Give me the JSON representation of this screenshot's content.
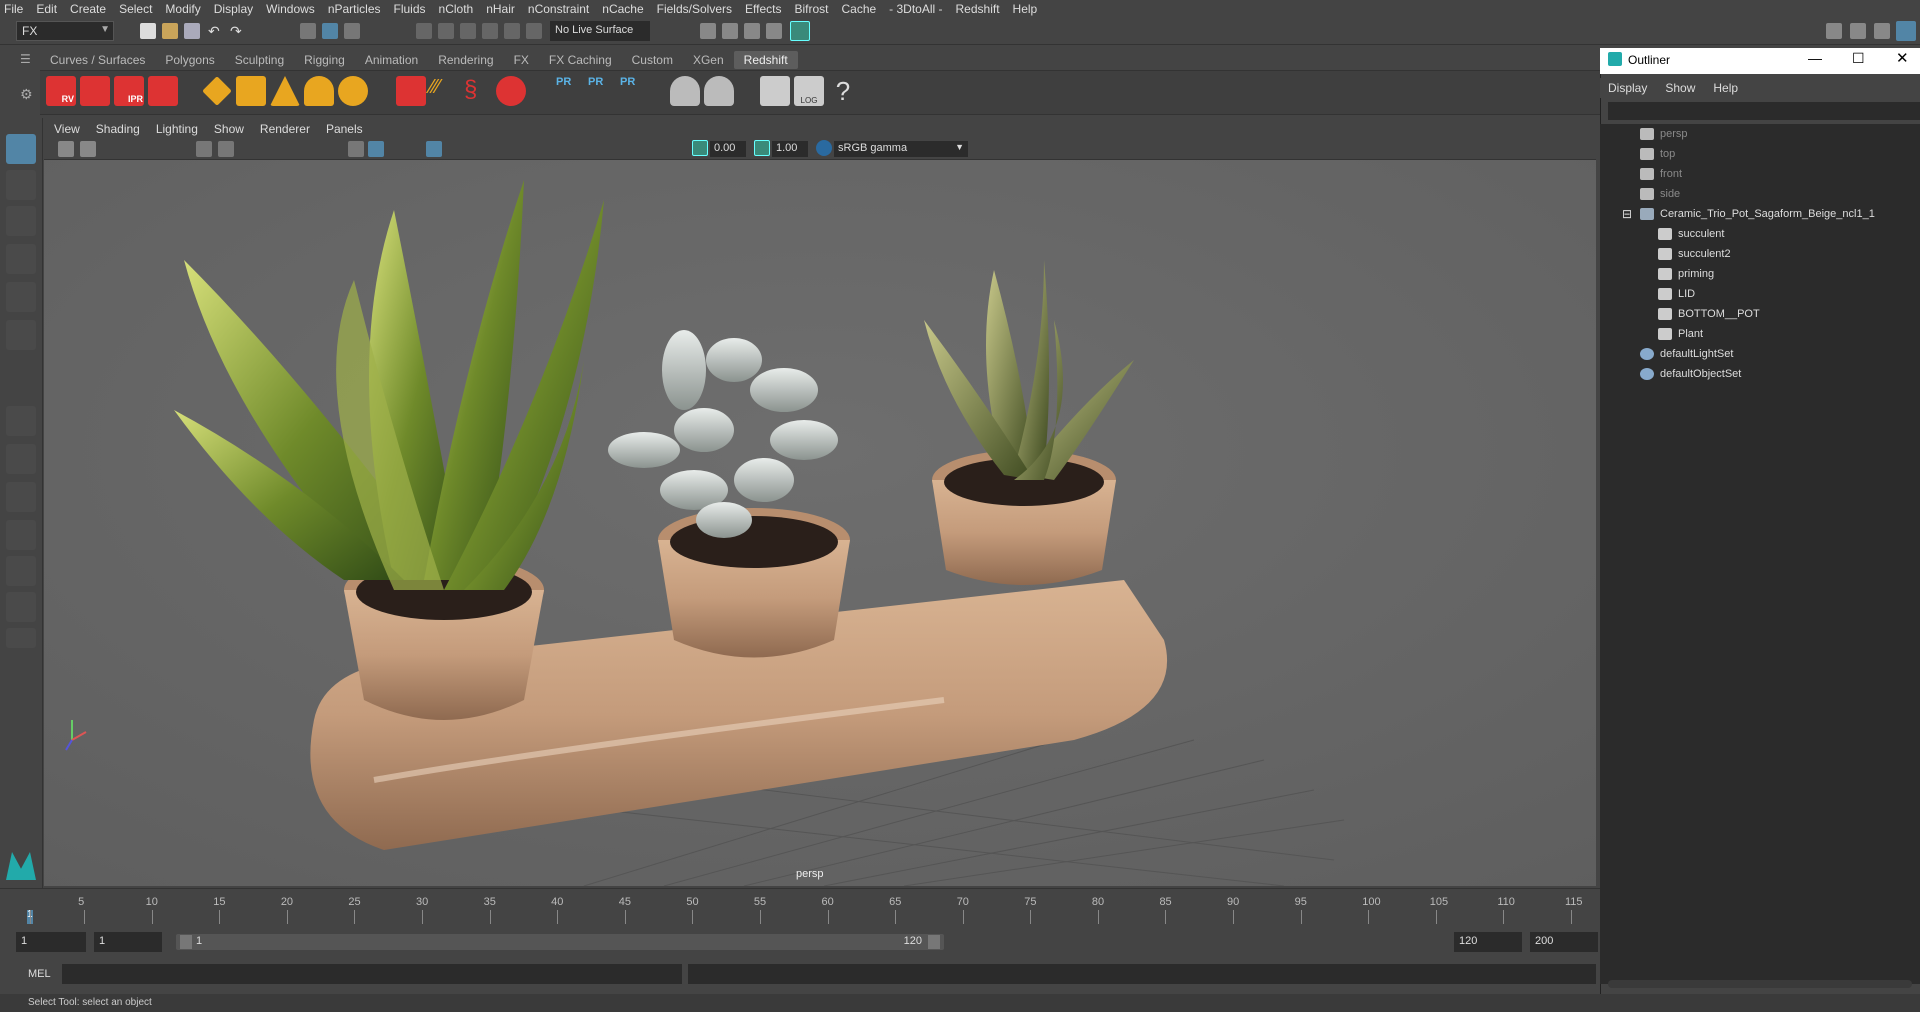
{
  "menubar": {
    "items": [
      "File",
      "Edit",
      "Create",
      "Select",
      "Modify",
      "Display",
      "Windows",
      "nParticles",
      "Fluids",
      "nCloth",
      "nHair",
      "nConstraint",
      "nCache",
      "Fields/Solvers",
      "Effects",
      "Bifrost",
      "Cache",
      "- 3DtoAll -",
      "Redshift",
      "Help"
    ]
  },
  "status": {
    "mode": "FX",
    "live_surface": "No Live Surface"
  },
  "shelf_tabs": [
    {
      "label": "Curves / Surfaces"
    },
    {
      "label": "Polygons"
    },
    {
      "label": "Sculpting"
    },
    {
      "label": "Rigging"
    },
    {
      "label": "Animation"
    },
    {
      "label": "Rendering"
    },
    {
      "label": "FX"
    },
    {
      "label": "FX Caching"
    },
    {
      "label": "Custom"
    },
    {
      "label": "XGen"
    },
    {
      "label": "Redshift",
      "active": true
    }
  ],
  "shelf_icons": {
    "rv": "RV",
    "ipr": "IPR",
    "pr": "PR",
    "log": "LOG",
    "help": "?"
  },
  "viewport": {
    "menu": [
      "View",
      "Shading",
      "Lighting",
      "Show",
      "Renderer",
      "Panels"
    ],
    "exposure": "0.00",
    "gamma": "1.00",
    "colorspace": "sRGB gamma",
    "camera_label": "persp"
  },
  "outliner": {
    "title": "Outliner",
    "menu": [
      "Display",
      "Show",
      "Help"
    ],
    "items": [
      {
        "label": "persp",
        "depth": 0,
        "dim": true,
        "icon": "camera-icon"
      },
      {
        "label": "top",
        "depth": 0,
        "dim": true,
        "icon": "camera-icon"
      },
      {
        "label": "front",
        "depth": 0,
        "dim": true,
        "icon": "camera-icon"
      },
      {
        "label": "side",
        "depth": 0,
        "dim": true,
        "icon": "camera-icon"
      },
      {
        "label": "Ceramic_Trio_Pot_Sagaform_Beige_ncl1_1",
        "depth": 0,
        "icon": "group-icon",
        "expanded": true
      },
      {
        "label": "succulent",
        "depth": 1,
        "icon": "mesh-icon"
      },
      {
        "label": "succulent2",
        "depth": 1,
        "icon": "mesh-icon"
      },
      {
        "label": "priming",
        "depth": 1,
        "icon": "mesh-icon"
      },
      {
        "label": "LID",
        "depth": 1,
        "icon": "mesh-icon"
      },
      {
        "label": "BOTTOM__POT",
        "depth": 1,
        "icon": "mesh-icon"
      },
      {
        "label": "Plant",
        "depth": 1,
        "icon": "mesh-icon"
      },
      {
        "label": "defaultLightSet",
        "depth": 0,
        "icon": "set-icon"
      },
      {
        "label": "defaultObjectSet",
        "depth": 0,
        "icon": "set-icon"
      }
    ]
  },
  "timeline": {
    "ticks": [
      "1",
      "5",
      "10",
      "15",
      "20",
      "25",
      "30",
      "35",
      "40",
      "45",
      "50",
      "55",
      "60",
      "65",
      "70",
      "75",
      "80",
      "85",
      "90",
      "95",
      "100",
      "105",
      "110",
      "115"
    ],
    "current_frame": "1"
  },
  "range": {
    "start": "1",
    "playback_start": "1",
    "slider_start": "1",
    "slider_end": "120",
    "playback_end": "120",
    "end": "200"
  },
  "cmdline": {
    "lang": "MEL"
  },
  "helpline": {
    "text": "Select Tool: select an object"
  },
  "colors": {
    "accent": "#5285a6",
    "bg": "#444444",
    "viewport": "#656565",
    "pot": "#c49b7b"
  }
}
